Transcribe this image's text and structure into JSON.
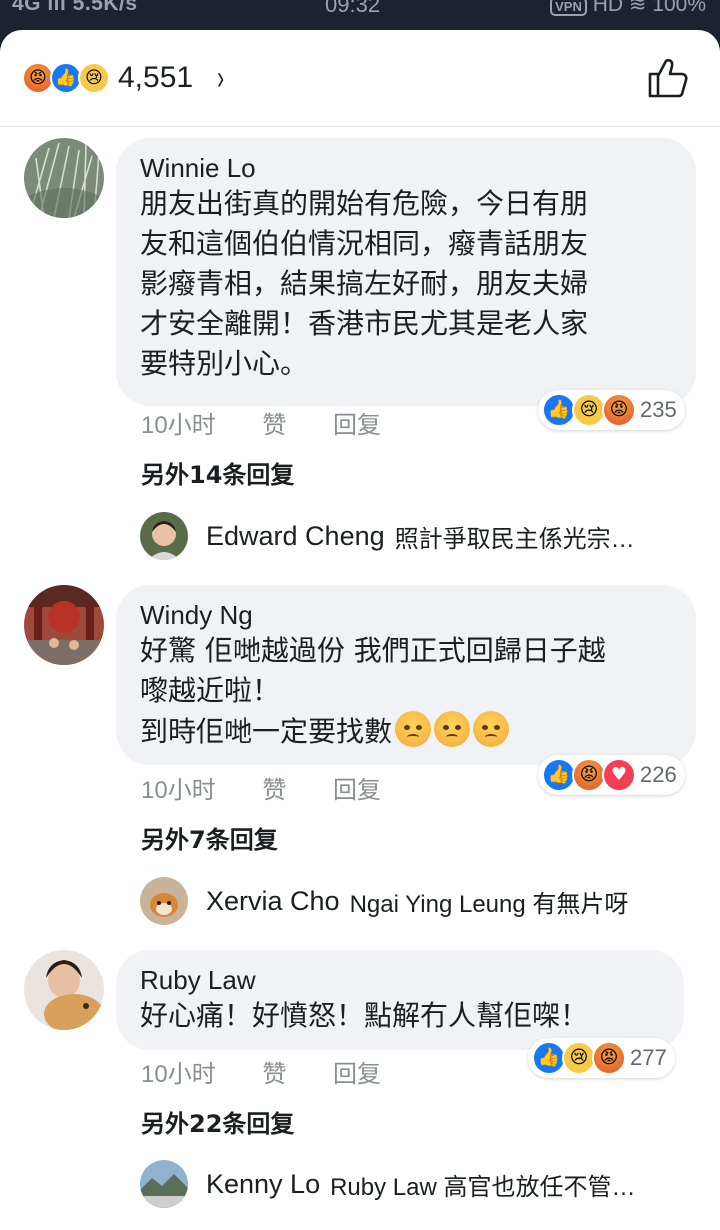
{
  "status_bar": {
    "left": "4G ıll 5.5K/s",
    "time": "09:32",
    "vpn": "VPN",
    "right": "HD ≋ 100%"
  },
  "header": {
    "reaction_count": "4,551",
    "chevron": "›"
  },
  "comments": [
    {
      "author": "Winnie Lo",
      "text": "朋友出街真的開始有危險，今日有朋\n友和這個伯伯情況相同，癈青話朋友\n影癈青相，結果搞左好耐，朋友夫婦\n才安全離開！香港市民尤其是老人家\n要特別小心。",
      "time": "10小时",
      "like_label": "赞",
      "reply_label": "回复",
      "reaction_count": "235",
      "more_replies": "另外14条回复",
      "reply_preview": {
        "name": "Edward Cheng",
        "text": "照計爭取民主係光宗…"
      }
    },
    {
      "author": "Windy Ng",
      "text": "好驚 佢哋越過份 我們正式回歸日子越\n嚟越近啦！\n到時佢哋一定要找數",
      "time": "10小时",
      "like_label": "赞",
      "reply_label": "回复",
      "reaction_count": "226",
      "more_replies": "另外7条回复",
      "reply_preview": {
        "name": "Xervia Cho",
        "text": "Ngai Ying Leung 有無片呀"
      }
    },
    {
      "author": "Ruby Law",
      "text": "好心痛！好憤怒！點解冇人幫佢㗎！",
      "time": "10小时",
      "like_label": "赞",
      "reply_label": "回复",
      "reaction_count": "277",
      "more_replies": "另外22条回复",
      "reply_preview": {
        "name": "Kenny Lo",
        "text": "Ruby Law 高官也放任不管…"
      }
    }
  ],
  "colors": {
    "like_blue": "#1877f2",
    "bubble_gray": "#f0f2f5",
    "secondary_text": "#8a8d91",
    "status_bar_bg": "#1c2230"
  }
}
